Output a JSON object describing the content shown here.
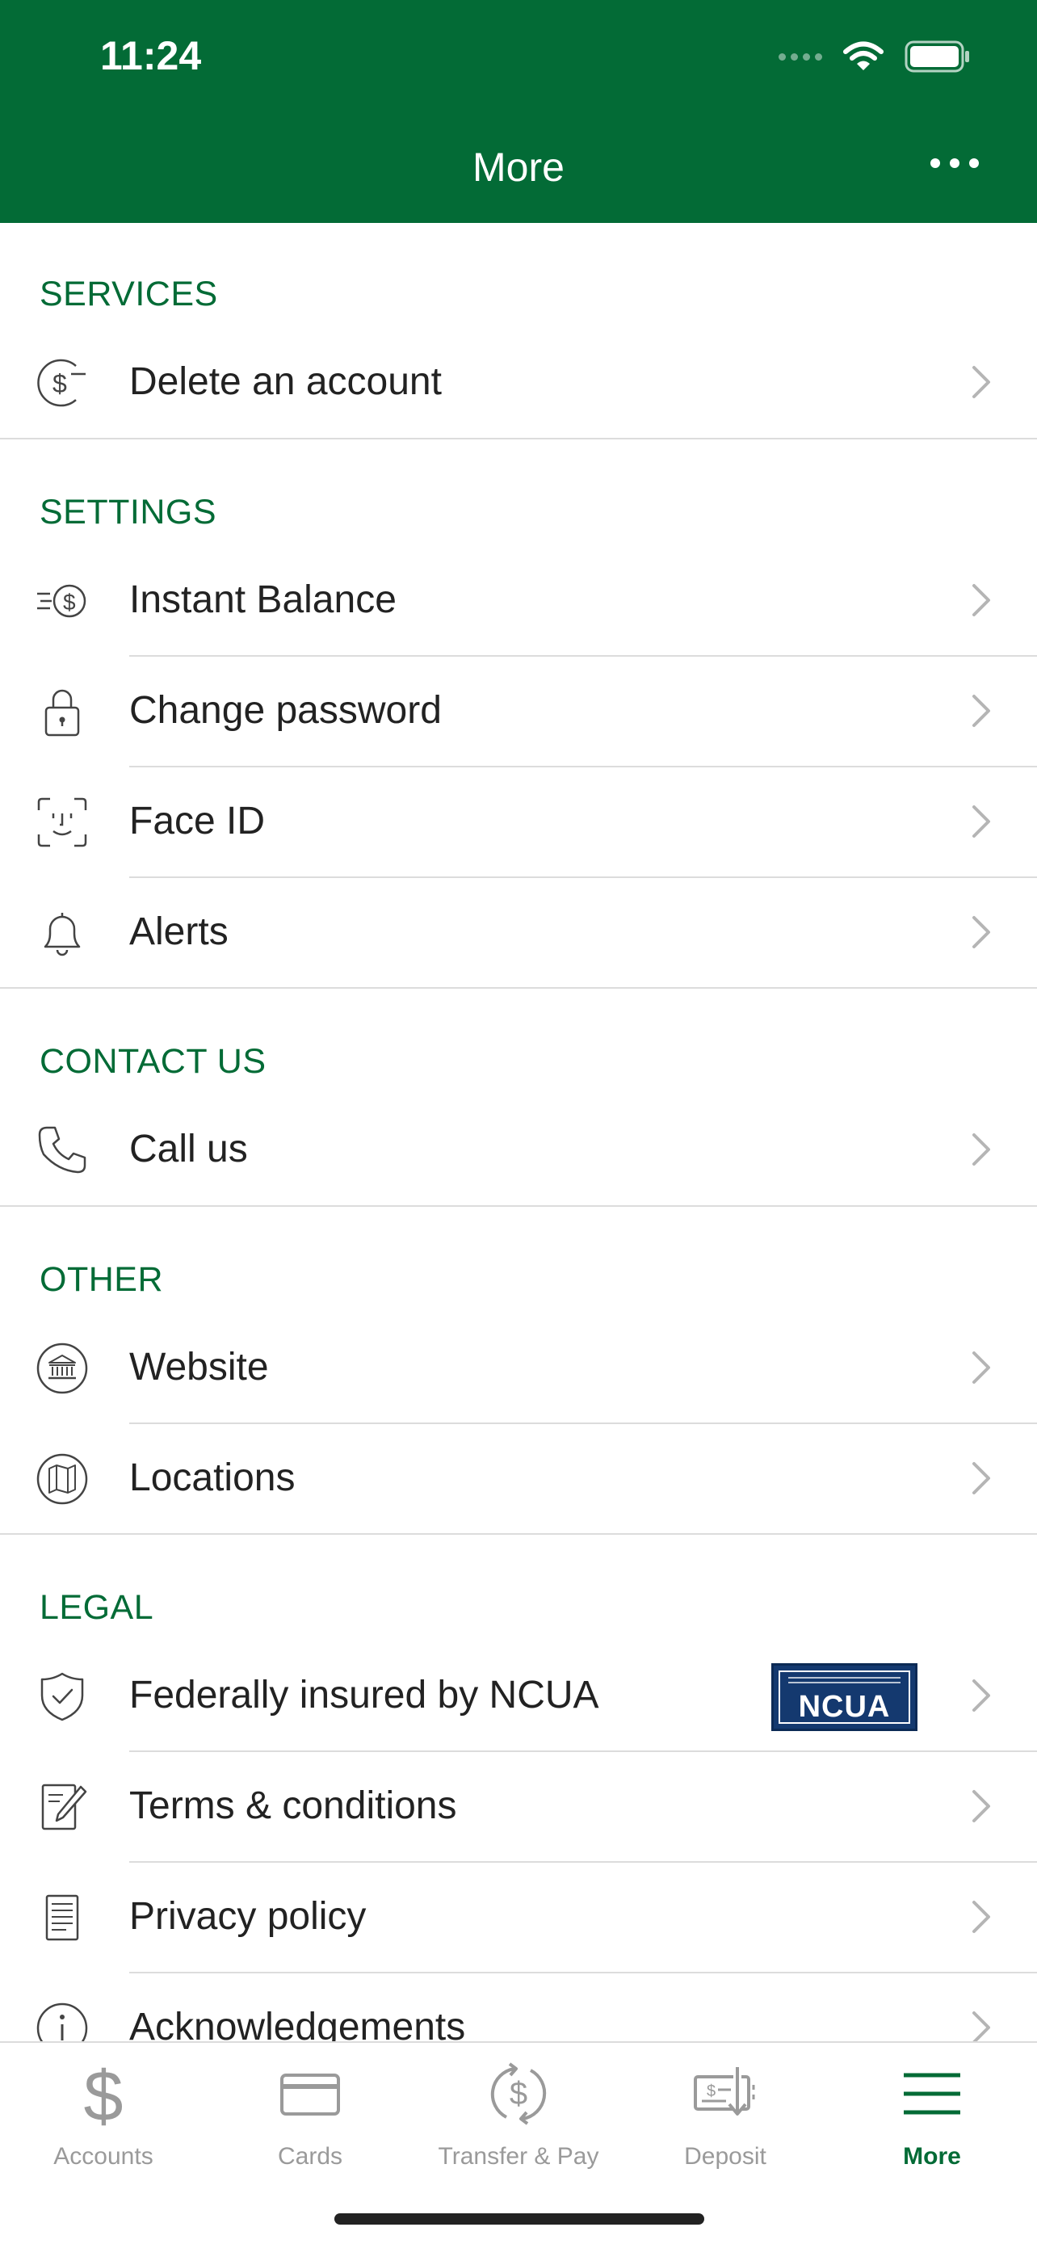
{
  "status_bar": {
    "time": "11:24"
  },
  "header": {
    "title": "More"
  },
  "sections": {
    "services": {
      "title": "SERVICES",
      "items": [
        {
          "label": "Delete an account",
          "icon": "dollar-minus-icon"
        }
      ]
    },
    "settings": {
      "title": "SETTINGS",
      "items": [
        {
          "label": "Instant Balance",
          "icon": "instant-balance-icon"
        },
        {
          "label": "Change password",
          "icon": "lock-icon"
        },
        {
          "label": "Face ID",
          "icon": "face-id-icon"
        },
        {
          "label": "Alerts",
          "icon": "bell-icon"
        }
      ]
    },
    "contact": {
      "title": "CONTACT US",
      "items": [
        {
          "label": "Call us",
          "icon": "phone-icon"
        }
      ]
    },
    "other": {
      "title": "OTHER",
      "items": [
        {
          "label": "Website",
          "icon": "bank-building-icon"
        },
        {
          "label": "Locations",
          "icon": "map-icon"
        }
      ]
    },
    "legal": {
      "title": "LEGAL",
      "items": [
        {
          "label": "Federally insured by NCUA",
          "icon": "shield-check-icon",
          "badge": "NCUA"
        },
        {
          "label": "Terms & conditions",
          "icon": "document-edit-icon"
        },
        {
          "label": "Privacy policy",
          "icon": "document-lines-icon"
        },
        {
          "label": "Acknowledgements",
          "icon": "info-icon"
        }
      ]
    }
  },
  "tabbar": {
    "tabs": [
      {
        "label": "Accounts",
        "icon": "dollar-icon",
        "active": false
      },
      {
        "label": "Cards",
        "icon": "card-icon",
        "active": false
      },
      {
        "label": "Transfer & Pay",
        "icon": "transfer-icon",
        "active": false
      },
      {
        "label": "Deposit",
        "icon": "check-deposit-icon",
        "active": false
      },
      {
        "label": "More",
        "icon": "menu-icon",
        "active": true
      }
    ]
  },
  "colors": {
    "brand_green": "#036b36",
    "ncua_blue": "#14396f",
    "inactive_gray": "#9a9a9a"
  }
}
